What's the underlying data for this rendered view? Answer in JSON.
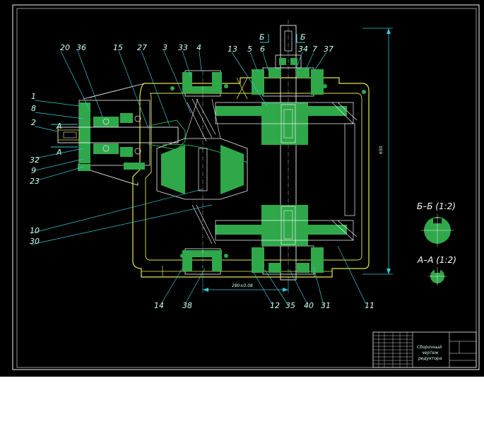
{
  "drawing": {
    "part_numbers": [
      "20",
      "36",
      "15",
      "27",
      "3",
      "33",
      "4",
      "13",
      "5",
      "6",
      "34",
      "7",
      "37",
      "1",
      "8",
      "2",
      "32",
      "9",
      "23",
      "10",
      "30",
      "14",
      "38",
      "12",
      "35",
      "40",
      "31",
      "11"
    ],
    "section_marks": {
      "A": "А",
      "B": "Б"
    },
    "section_views": [
      {
        "title": "Б–Б (1:2)"
      },
      {
        "title": "А–А (1:2)"
      }
    ],
    "dimensions": {
      "center_distance": "280±0.08",
      "height": "650"
    }
  },
  "title_block": {
    "name_line1": "Сборочный",
    "name_line2": "чертеж",
    "name_line3": "редуктора"
  },
  "colors": {
    "background": "#000000",
    "border": "#e8e8e8",
    "body_outline": "#e8e84a",
    "leaders": "#36c6d6",
    "hatch": "#2fa84a",
    "parts": "#f2f2f2"
  }
}
